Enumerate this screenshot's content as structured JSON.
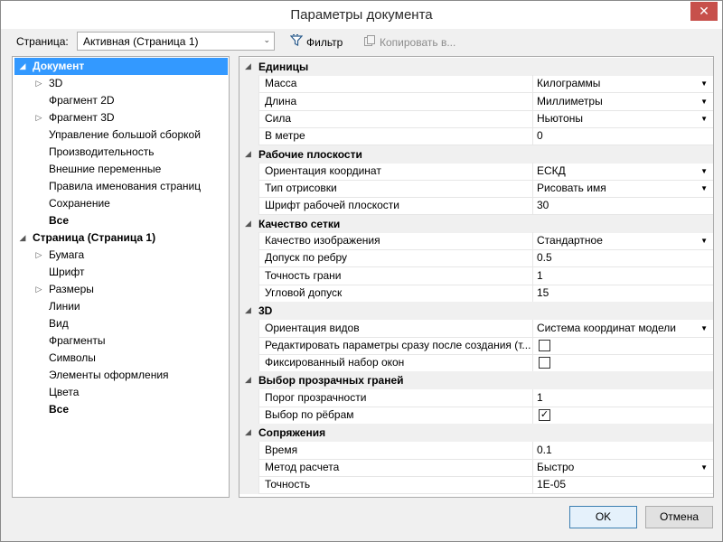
{
  "window": {
    "title": "Параметры документа",
    "close_glyph": "✕"
  },
  "toolbar": {
    "page_label": "Страница:",
    "page_combo_value": "Активная (Страница 1)",
    "filter_label": "Фильтр",
    "copy_label": "Копировать в..."
  },
  "tree": [
    {
      "label": "Документ",
      "level": 0,
      "expander": "expanded",
      "bold": true,
      "selected": true
    },
    {
      "label": "3D",
      "level": 1,
      "expander": "collapsed"
    },
    {
      "label": "Фрагмент 2D",
      "level": 1
    },
    {
      "label": "Фрагмент 3D",
      "level": 1,
      "expander": "collapsed"
    },
    {
      "label": "Управление большой сборкой",
      "level": 1
    },
    {
      "label": "Производительность",
      "level": 1
    },
    {
      "label": "Внешние переменные",
      "level": 1
    },
    {
      "label": "Правила именования страниц",
      "level": 1
    },
    {
      "label": "Сохранение",
      "level": 1
    },
    {
      "label": "Все",
      "level": 1,
      "bold": true
    },
    {
      "label": "Страница (Страница 1)",
      "level": 0,
      "expander": "expanded",
      "bold": true
    },
    {
      "label": "Бумага",
      "level": 1,
      "expander": "collapsed"
    },
    {
      "label": "Шрифт",
      "level": 1
    },
    {
      "label": "Размеры",
      "level": 1,
      "expander": "collapsed"
    },
    {
      "label": "Линии",
      "level": 1
    },
    {
      "label": "Вид",
      "level": 1
    },
    {
      "label": "Фрагменты",
      "level": 1
    },
    {
      "label": "Символы",
      "level": 1
    },
    {
      "label": "Элементы оформления",
      "level": 1
    },
    {
      "label": "Цвета",
      "level": 1
    },
    {
      "label": "Все",
      "level": 1,
      "bold": true
    }
  ],
  "properties": [
    {
      "type": "category",
      "label": "Единицы"
    },
    {
      "type": "prop",
      "name": "Масса",
      "value": "Килограммы",
      "dropdown": true
    },
    {
      "type": "prop",
      "name": "Длина",
      "value": "Миллиметры",
      "dropdown": true
    },
    {
      "type": "prop",
      "name": "Сила",
      "value": "Ньютоны",
      "dropdown": true
    },
    {
      "type": "prop",
      "name": "В метре",
      "value": "0"
    },
    {
      "type": "category",
      "label": "Рабочие плоскости"
    },
    {
      "type": "prop",
      "name": "Ориентация координат",
      "value": "ЕСКД",
      "dropdown": true
    },
    {
      "type": "prop",
      "name": "Тип отрисовки",
      "value": "Рисовать имя",
      "dropdown": true
    },
    {
      "type": "prop",
      "name": "Шрифт рабочей плоскости",
      "value": "30"
    },
    {
      "type": "category",
      "label": "Качество сетки"
    },
    {
      "type": "prop",
      "name": "Качество изображения",
      "value": "Стандартное",
      "dropdown": true
    },
    {
      "type": "prop",
      "name": "Допуск по ребру",
      "value": "0.5"
    },
    {
      "type": "prop",
      "name": "Точность грани",
      "value": "1"
    },
    {
      "type": "prop",
      "name": "Угловой допуск",
      "value": "15"
    },
    {
      "type": "category",
      "label": "3D"
    },
    {
      "type": "prop",
      "name": "Ориентация видов",
      "value": "Система координат модели",
      "dropdown": true
    },
    {
      "type": "prop",
      "name": "Редактировать параметры сразу после создания (т...",
      "checkbox": true,
      "checked": false
    },
    {
      "type": "prop",
      "name": "Фиксированный набор окон",
      "checkbox": true,
      "checked": false
    },
    {
      "type": "category",
      "label": "Выбор прозрачных граней"
    },
    {
      "type": "prop",
      "name": "Порог прозрачности",
      "value": "1"
    },
    {
      "type": "prop",
      "name": "Выбор по рёбрам",
      "checkbox": true,
      "checked": true
    },
    {
      "type": "category",
      "label": "Сопряжения"
    },
    {
      "type": "prop",
      "name": "Время",
      "value": "0.1"
    },
    {
      "type": "prop",
      "name": "Метод расчета",
      "value": "Быстро",
      "dropdown": true
    },
    {
      "type": "prop",
      "name": "Точность",
      "value": "1E-05"
    }
  ],
  "buttons": {
    "ok": "OK",
    "cancel": "Отмена"
  },
  "colors": {
    "selection": "#3399ff",
    "close": "#c7504b"
  }
}
